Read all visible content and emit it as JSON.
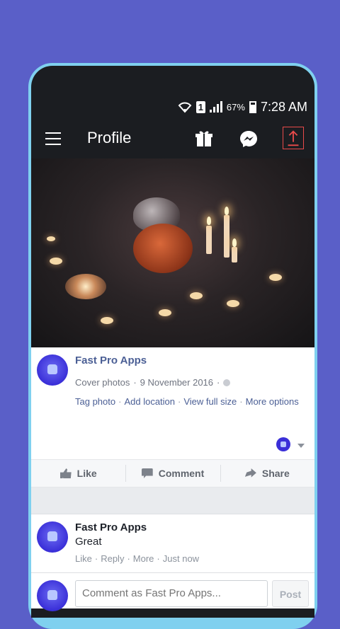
{
  "colors": {
    "background": "#5a5fc8",
    "toolbar": "#1b1d21",
    "link": "#4b5f95",
    "upload_border": "#e84a4a"
  },
  "status_bar": {
    "sim_number": "1",
    "battery": "67%",
    "time": "7:28 AM",
    "icons": [
      "wifi-icon",
      "signal-icon",
      "battery-icon"
    ]
  },
  "toolbar": {
    "title": "Profile",
    "icons": [
      "menu-icon",
      "gift-icon",
      "messenger-icon",
      "upload-icon"
    ]
  },
  "post": {
    "author": "Fast Pro Apps",
    "album": "Cover photos",
    "date": "9 November 2016",
    "links": [
      "Tag photo",
      "Add location",
      "View full size",
      "More options"
    ],
    "actions": {
      "like": "Like",
      "comment": "Comment",
      "share": "Share"
    }
  },
  "comment": {
    "author": "Fast Pro Apps",
    "text": "Great",
    "links": [
      "Like",
      "Reply",
      "More",
      "Just now"
    ]
  },
  "composer": {
    "placeholder": "Comment as Fast Pro Apps...",
    "post_label": "Post"
  }
}
